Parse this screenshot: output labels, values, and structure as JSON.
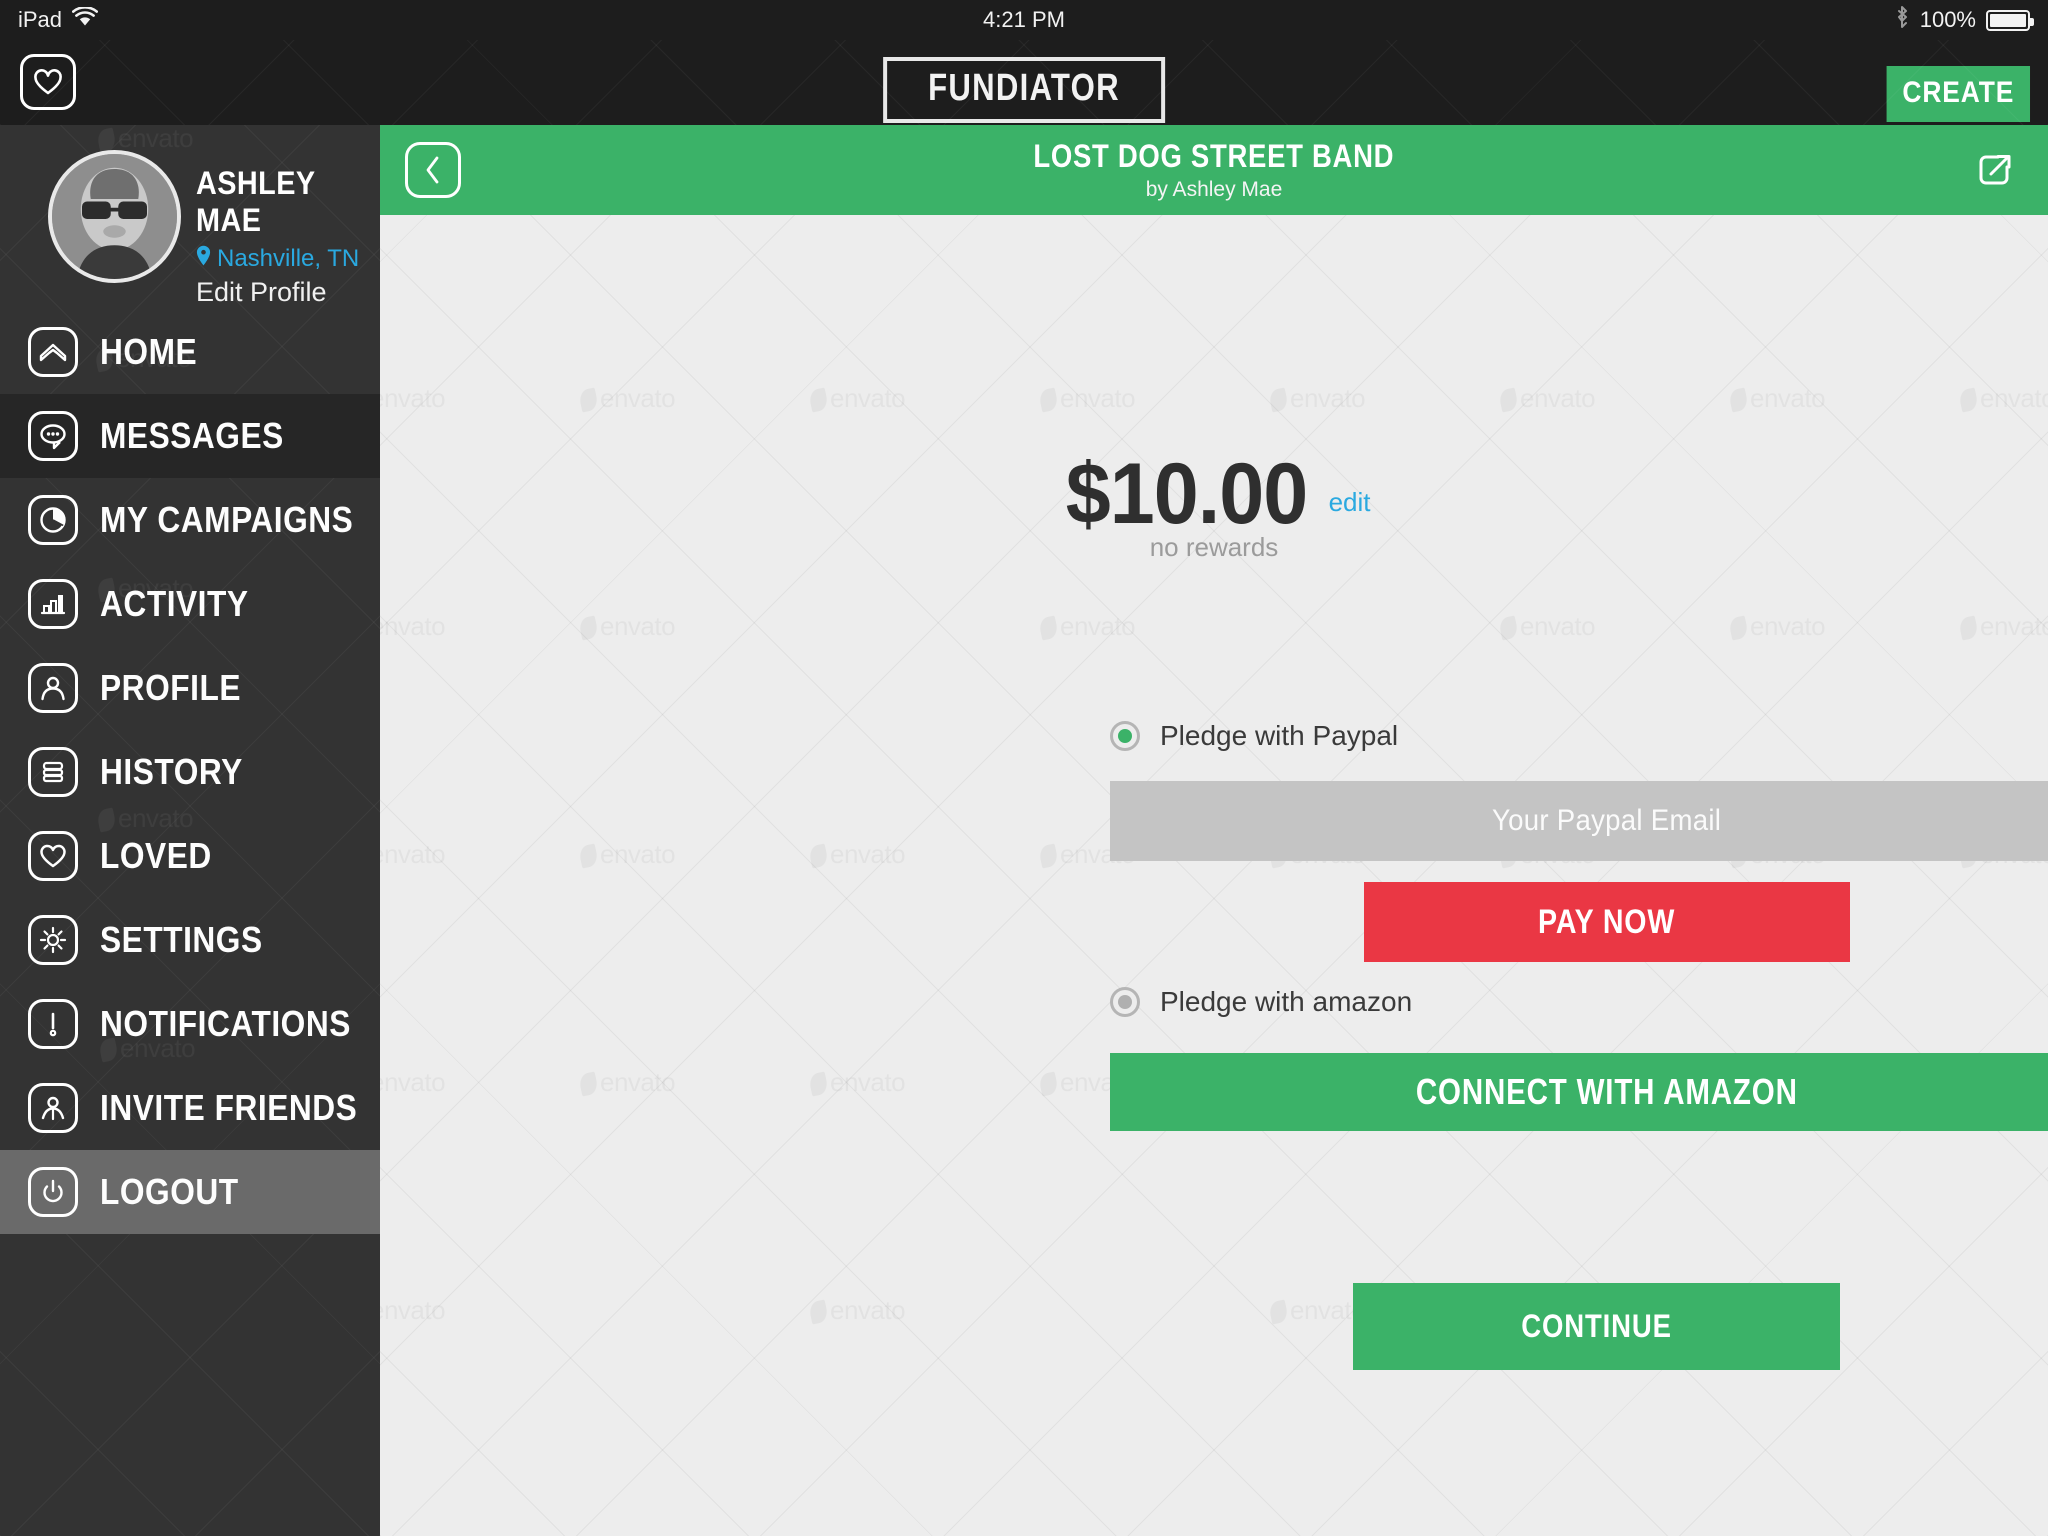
{
  "status_bar": {
    "device": "iPad",
    "wifi_icon": "wifi-icon",
    "time": "4:21 PM",
    "bluetooth_icon": "bluetooth-icon",
    "battery_percent": "100%"
  },
  "app_bar": {
    "heart_icon": "heart-icon",
    "brand": "FUNDIATOR",
    "create_label": "CREATE"
  },
  "sidebar": {
    "profile": {
      "name": "ASHLEY MAE",
      "location": "Nashville, TN",
      "location_icon": "map-pin-icon",
      "edit_label": "Edit Profile",
      "avatar_icon": "avatar"
    },
    "items": [
      {
        "label": "HOME",
        "icon": "home-icon",
        "active": false
      },
      {
        "label": "MESSAGES",
        "icon": "chat-bubble-icon",
        "active": true
      },
      {
        "label": "MY CAMPAIGNS",
        "icon": "pie-chart-icon",
        "active": false
      },
      {
        "label": "ACTIVITY",
        "icon": "bar-chart-icon",
        "active": false
      },
      {
        "label": "PROFILE",
        "icon": "person-icon",
        "active": false
      },
      {
        "label": "HISTORY",
        "icon": "list-icon",
        "active": false
      },
      {
        "label": "LOVED",
        "icon": "heart-icon",
        "active": false
      },
      {
        "label": "SETTINGS",
        "icon": "gear-icon",
        "active": false
      },
      {
        "label": "NOTIFICATIONS",
        "icon": "exclamation-icon",
        "active": false
      },
      {
        "label": "INVITE FRIENDS",
        "icon": "add-person-icon",
        "active": false
      },
      {
        "label": "LOGOUT",
        "icon": "power-icon",
        "active": false
      }
    ]
  },
  "campaign_bar": {
    "back_icon": "chevron-left-icon",
    "title": "LOST DOG STREET BAND",
    "byline": "by Ashley Mae",
    "share_icon": "share-external-icon"
  },
  "pledge": {
    "amount": "$10.00",
    "edit_label": "edit",
    "rewards_note": "no rewards",
    "options": [
      {
        "label": "Pledge with Paypal",
        "selected": true
      },
      {
        "label": "Pledge with amazon",
        "selected": false
      }
    ],
    "paypal_placeholder": "Your Paypal Email",
    "pay_now_label": "PAY NOW",
    "amazon_label": "CONNECT WITH AMAZON",
    "continue_label": "CONTINUE"
  },
  "colors": {
    "accent_green": "#3bb268",
    "danger_red": "#ea3744",
    "link_blue": "#2aa9e0",
    "sidebar_bg": "#333333",
    "content_bg": "#ededed"
  },
  "watermark": "envato"
}
